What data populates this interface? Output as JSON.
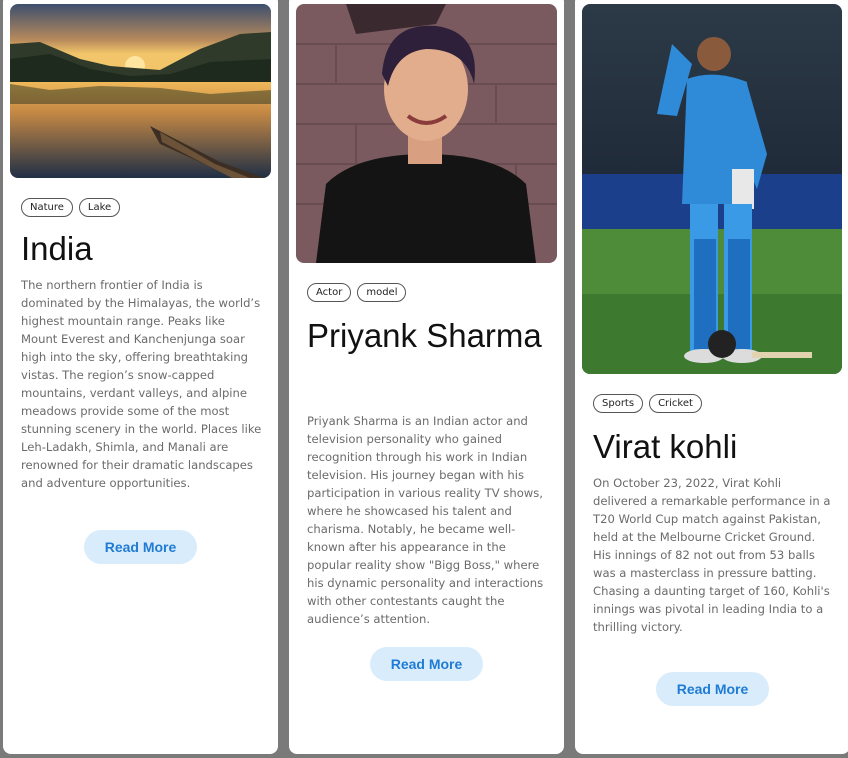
{
  "cards": [
    {
      "title": "India",
      "tags": [
        "Nature",
        "Lake"
      ],
      "description": "The northern frontier of India is dominated by the Himalayas, the world’s highest mountain range. Peaks like Mount Everest and Kanchenjunga soar high into the sky, offering breathtaking vistas. The region’s snow-capped mountains, verdant valleys, and alpine meadows provide some of the most stunning scenery in the world. Places like Leh-Ladakh, Shimla, and Manali are renowned for their dramatic landscapes and adventure opportunities.",
      "button_label": "Read More"
    },
    {
      "title": "Priyank Sharma",
      "tags": [
        "Actor",
        "model"
      ],
      "description": "Priyank Sharma is an Indian actor and television personality who gained recognition through his work in Indian television. His journey began with his participation in various reality TV shows, where he showcased his talent and charisma. Notably, he became well-known after his appearance in the popular reality show \"Bigg Boss,\" where his dynamic personality and interactions with other contestants caught the audience’s attention.",
      "button_label": "Read More"
    },
    {
      "title": "Virat kohli",
      "tags": [
        "Sports",
        "Cricket"
      ],
      "description": "On October 23, 2022, Virat Kohli delivered a remarkable performance in a T20 World Cup match against Pakistan, held at the Melbourne Cricket Ground. His innings of 82 not out from 53 balls was a masterclass in pressure batting. Chasing a daunting target of 160, Kohli's innings was pivotal in leading India to a thrilling victory.",
      "button_label": "Read More"
    }
  ],
  "colors": {
    "page_background": "#7a7a7a",
    "card_background": "#ffffff",
    "button_background": "#d9ecfb",
    "button_text": "#1f7bd4",
    "description_text": "#6b6b6b"
  }
}
